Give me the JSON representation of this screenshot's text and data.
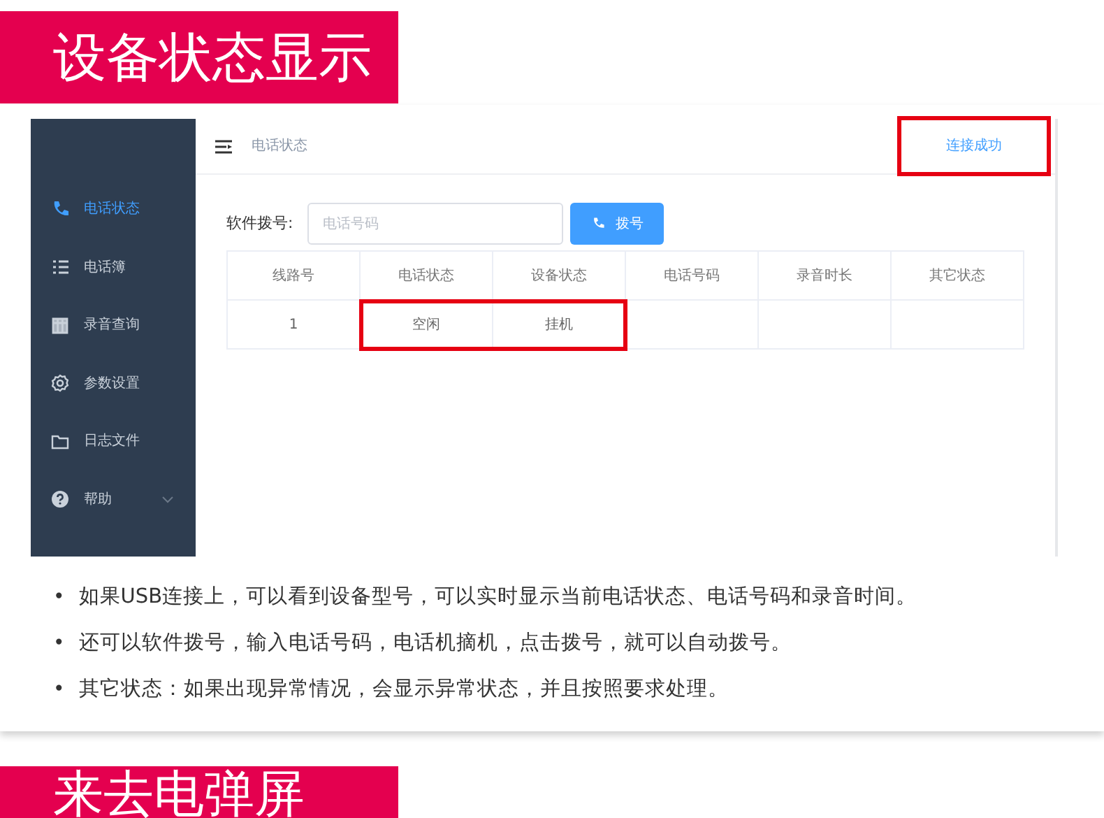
{
  "banner": {
    "title": "设备状态显示"
  },
  "app": {
    "sidebar": {
      "items": [
        {
          "kind": "phone",
          "label": "电话状态",
          "selected": true,
          "expandable": false
        },
        {
          "kind": "list",
          "label": "电话簿",
          "selected": false,
          "expandable": false
        },
        {
          "kind": "grid",
          "label": "录音查询",
          "selected": false,
          "expandable": false
        },
        {
          "kind": "gear",
          "label": "参数设置",
          "selected": false,
          "expandable": false
        },
        {
          "kind": "folder",
          "label": "日志文件",
          "selected": false,
          "expandable": false
        },
        {
          "kind": "help",
          "label": "帮助",
          "selected": false,
          "expandable": true
        }
      ]
    },
    "header": {
      "breadcrumb": "电话状态",
      "connection": {
        "text": "连接成功",
        "highlighted": true
      }
    },
    "dial": {
      "label": "软件拨号:",
      "placeholder": "电话号码",
      "button": "拨号"
    },
    "table": {
      "columns": [
        "线路号",
        "电话状态",
        "设备状态",
        "电话号码",
        "录音时长",
        "其它状态"
      ],
      "rows": [
        {
          "cells": [
            {
              "text": "1",
              "highlighted": false
            },
            {
              "text": "空闲",
              "highlighted": true
            },
            {
              "text": "挂机",
              "highlighted": true
            }
          ]
        }
      ]
    }
  },
  "notes": [
    {
      "bullet": "•",
      "text": "如果USB连接上，可以看到设备型号，可以实时显示当前电话状态、电话号码和录音时间。"
    },
    {
      "bullet": "•",
      "text": "还可以软件拨号，输入电话号码，电话机摘机，点击拨号，就可以自动拨号。"
    },
    {
      "bullet": "•",
      "text": "其它状态：如果出现异常情况，会显示异常状态，并且按照要求处理。"
    }
  ],
  "next_banner": {
    "title": "来去电弹屏"
  }
}
